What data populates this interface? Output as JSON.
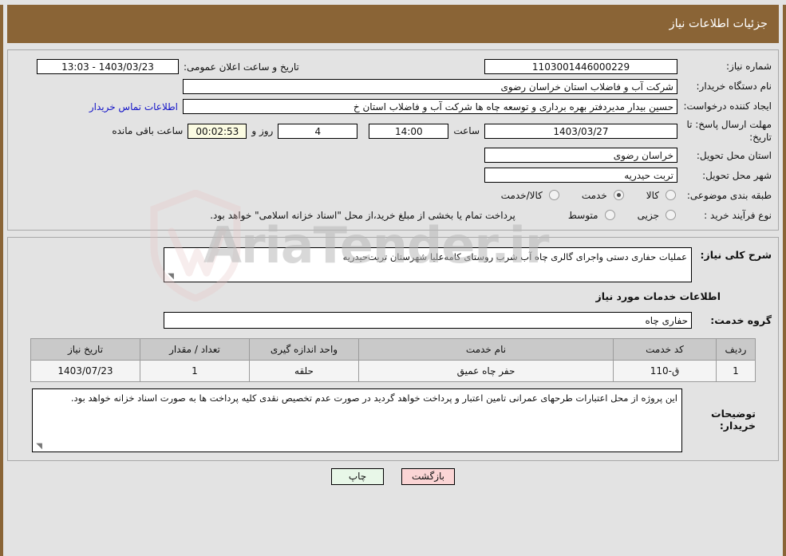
{
  "header": {
    "title": "جزئیات اطلاعات نیاز",
    "bar_color": "#8a6436"
  },
  "form": {
    "need_number_label": "شماره نیاز:",
    "need_number_value": "1103001446000229",
    "public_announce_label": "تاریخ و ساعت اعلان عمومی:",
    "public_announce_value": "1403/03/23 - 13:03",
    "buyer_org_label": "نام دستگاه خریدار:",
    "buyer_org_value": "شرکت آب و فاضلاب استان خراسان رضوی",
    "creator_label": "ایجاد کننده درخواست:",
    "creator_value": "حسین  بیدار مدیردفتر بهره برداری و توسعه چاه ها شرکت آب و فاضلاب استان خ",
    "contact_link": "اطلاعات تماس خریدار",
    "deadline_label": "مهلت ارسال پاسخ: تا تاریخ:",
    "deadline_date": "1403/03/27",
    "hour_label": "ساعت",
    "hour_value": "14:00",
    "days_value": "4",
    "days_label": "روز و",
    "countdown_value": "00:02:53",
    "countdown_label": "ساعت باقی مانده",
    "province_label": "استان محل تحویل:",
    "province_value": "خراسان رضوی",
    "city_label": "شهر محل تحویل:",
    "city_value": "تربت حیدریه",
    "category_label": "طبقه بندی موضوعی:",
    "category_options": [
      {
        "label": "کالا",
        "selected": false
      },
      {
        "label": "خدمت",
        "selected": true
      },
      {
        "label": "کالا/خدمت",
        "selected": false
      }
    ],
    "process_label": "نوع فرآیند خرید :",
    "process_options": [
      {
        "label": "جزیی",
        "selected": false
      },
      {
        "label": "متوسط",
        "selected": false
      }
    ],
    "process_note": "پرداخت تمام یا بخشی از مبلغ خرید،از محل \"اسناد خزانه اسلامی\" خواهد بود."
  },
  "description": {
    "general_label": "شرح کلی نیاز:",
    "general_value": "عملیات حفاری دستی واجرای گالری چاه آب شرب روستای کامه‌علیا شهرستان تربت‌حیدریه",
    "services_section_title": "اطلاعات خدمات مورد نیاز",
    "service_group_label": "گروه خدمت:",
    "service_group_value": "حفاری چاه"
  },
  "table": {
    "columns": [
      "ردیف",
      "کد خدمت",
      "نام خدمت",
      "واحد اندازه گیری",
      "تعداد / مقدار",
      "تاریخ نیاز"
    ],
    "rows": [
      {
        "row_no": "1",
        "service_code": "ق-110",
        "service_name": "حفر چاه عمیق",
        "unit": "حلقه",
        "quantity": "1",
        "need_date": "1403/07/23"
      }
    ]
  },
  "buyer_note": {
    "label": "توضیحات خریدار:",
    "value": "این پروژه از محل اعتبارات طرحهای عمرانی تامین اعتبار و پرداخت خواهد گردید در صورت عدم تخصیص نقدی کلیه پرداخت ها به صورت اسناد خزانه خواهد بود."
  },
  "footer": {
    "print_label": "چاپ",
    "back_label": "بازگشت"
  },
  "watermark": {
    "text": "AriaTender.ir"
  }
}
